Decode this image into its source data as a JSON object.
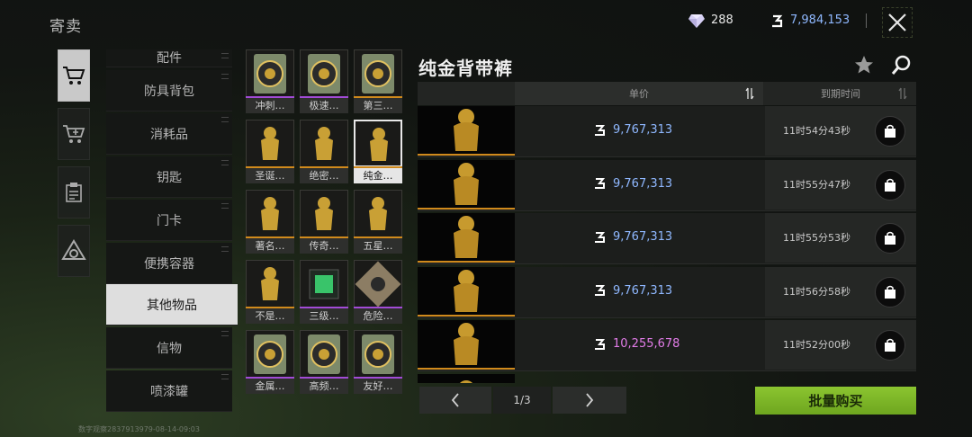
{
  "header": {
    "title": "寄卖",
    "gems": "288",
    "coins": "7,984,153"
  },
  "rail": [
    {
      "icon": "cart-icon",
      "active": true
    },
    {
      "icon": "cart-add-icon",
      "active": false
    },
    {
      "icon": "clipboard-icon",
      "active": false
    },
    {
      "icon": "triangle-logo-icon",
      "active": false
    }
  ],
  "categories": [
    "配件",
    "防具背包",
    "消耗品",
    "钥匙",
    "门卡",
    "便携容器",
    "其他物品",
    "信物",
    "喷漆罐"
  ],
  "selected_category": "其他物品",
  "items": [
    {
      "label": "冲刺…",
      "bar": "#a24bd6"
    },
    {
      "label": "极速…",
      "bar": "#a24bd6"
    },
    {
      "label": "第三…",
      "bar": "#d08a1c"
    },
    {
      "label": "圣诞…",
      "bar": "#d08a1c"
    },
    {
      "label": "绝密…",
      "bar": "#d08a1c"
    },
    {
      "label": "纯金…",
      "bar": "#d08a1c",
      "selected": true
    },
    {
      "label": "著名…",
      "bar": "#d08a1c"
    },
    {
      "label": "传奇…",
      "bar": "#d08a1c"
    },
    {
      "label": "五星…",
      "bar": "#d08a1c"
    },
    {
      "label": "不是…",
      "bar": "#d08a1c"
    },
    {
      "label": "三级…",
      "bar": "#a24bd6"
    },
    {
      "label": "危险…",
      "bar": "#a24bd6"
    },
    {
      "label": "金属…",
      "bar": "#a24bd6"
    },
    {
      "label": "高频…",
      "bar": "#a24bd6"
    },
    {
      "label": "友好…",
      "bar": "#a24bd6"
    }
  ],
  "panel": {
    "title": "纯金背带裤",
    "col_price": "单价",
    "col_expire": "到期时间"
  },
  "listings": [
    {
      "price": "9,767,313",
      "expire": "11时54分43秒",
      "color": "blue"
    },
    {
      "price": "9,767,313",
      "expire": "11时55分47秒",
      "color": "blue"
    },
    {
      "price": "9,767,313",
      "expire": "11时55分53秒",
      "color": "blue"
    },
    {
      "price": "9,767,313",
      "expire": "11时56分58秒",
      "color": "blue"
    },
    {
      "price": "10,255,678",
      "expire": "11时52分00秒",
      "color": "pink"
    }
  ],
  "pagination": {
    "page": "1/3"
  },
  "batch_buy": "批量购买",
  "watermark": "数字观察2837913979-08-14-09:03",
  "colors": {
    "accent_green": "#8bc530",
    "coin_blue": "#8fb8ff",
    "price_pink": "#e27ce8",
    "rarity_gold": "#d08a1c",
    "rarity_purple": "#a24bd6"
  }
}
